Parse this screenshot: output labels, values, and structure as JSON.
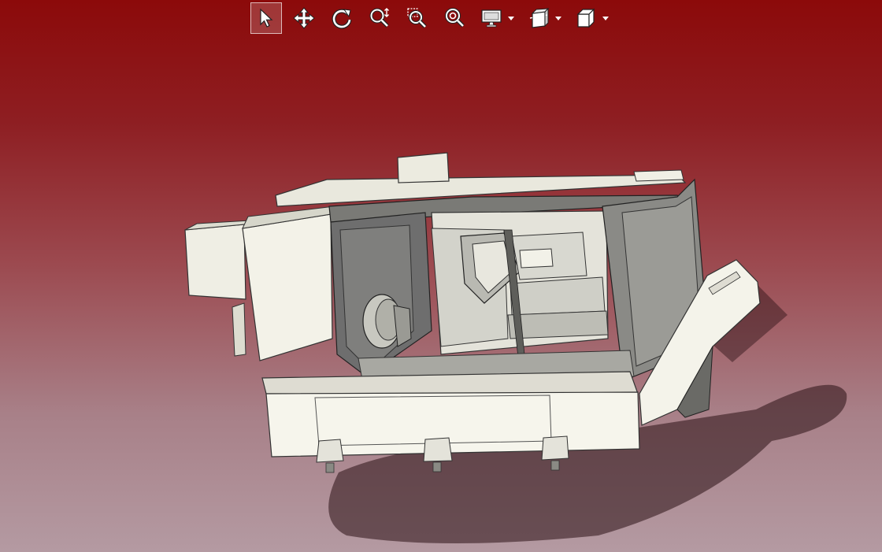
{
  "toolbar": {
    "tools": [
      {
        "icon": "select-pointer-icon",
        "active": true
      },
      {
        "icon": "pan-move-icon",
        "active": false
      },
      {
        "icon": "rotate-icon",
        "active": false
      },
      {
        "icon": "zoom-in-out-icon",
        "active": false
      },
      {
        "icon": "zoom-window-icon",
        "active": false
      },
      {
        "icon": "zoom-fit-icon",
        "active": false
      }
    ],
    "dropdowns": [
      {
        "icon": "display-mode-icon"
      },
      {
        "icon": "section-view-icon"
      },
      {
        "icon": "view-cube-icon"
      }
    ]
  },
  "viewport": {
    "model": "cnc-lathe-machine",
    "background_top": "#8c0a0a",
    "background_bottom": "#b49aa2"
  }
}
